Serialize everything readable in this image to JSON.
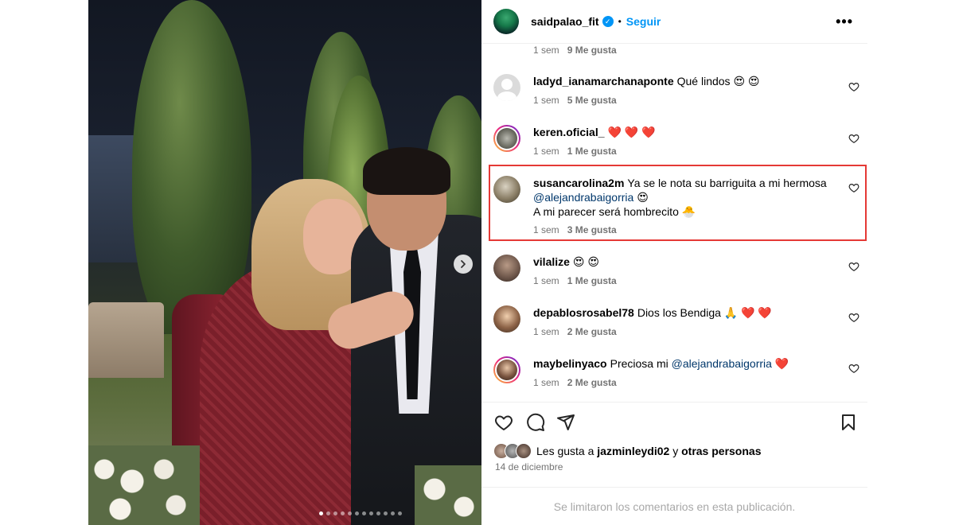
{
  "post": {
    "username": "saidpalao_fit",
    "verified_mark": "✓",
    "separator": "•",
    "follow_label": "Seguir",
    "more_label": "•••"
  },
  "top_meta": {
    "time": "1 sem",
    "likes": "9 Me gusta"
  },
  "comments": [
    {
      "user": "ladyd_ianamarchanaponte",
      "text": "Qué lindos 😍 😍",
      "time": "1 sem",
      "likes": "5 Me gusta"
    },
    {
      "user": "keren.oficial_",
      "text": "❤️ ❤️ ❤️",
      "time": "1 sem",
      "likes": "1 Me gusta"
    },
    {
      "user": "susancarolina2m",
      "text": "Ya se le nota su barriguita a mi hermosa",
      "mention": "@alejandrabaigorria",
      "text_after": "😍",
      "line2": "A mi parecer será hombrecito 🐣",
      "time": "1 sem",
      "likes": "3 Me gusta"
    },
    {
      "user": "vilalize",
      "text": "😍 😍",
      "time": "1 sem",
      "likes": "1 Me gusta"
    },
    {
      "user": "depablosrosabel78",
      "text": "Dios los Bendiga 🙏 ❤️ ❤️",
      "time": "1 sem",
      "likes": "2 Me gusta"
    },
    {
      "user": "maybelinyaco",
      "text": "Preciosa mi",
      "mention": "@alejandrabaigorria",
      "text_after": "❤️",
      "time": "1 sem",
      "likes": "2 Me gusta"
    }
  ],
  "likes_summary": {
    "prefix": "Les gusta a",
    "user": "jazminleydi02",
    "mid": "y",
    "suffix": "otras personas"
  },
  "date": "14 de diciembre",
  "footer_text": "Se limitaron los comentarios en esta publicación.",
  "carousel": {
    "slide_count": 12,
    "active_index": 0
  },
  "colors": {
    "accent": "#0095f6",
    "mention": "#00376b",
    "highlight": "#e53935",
    "meta": "#737373"
  }
}
